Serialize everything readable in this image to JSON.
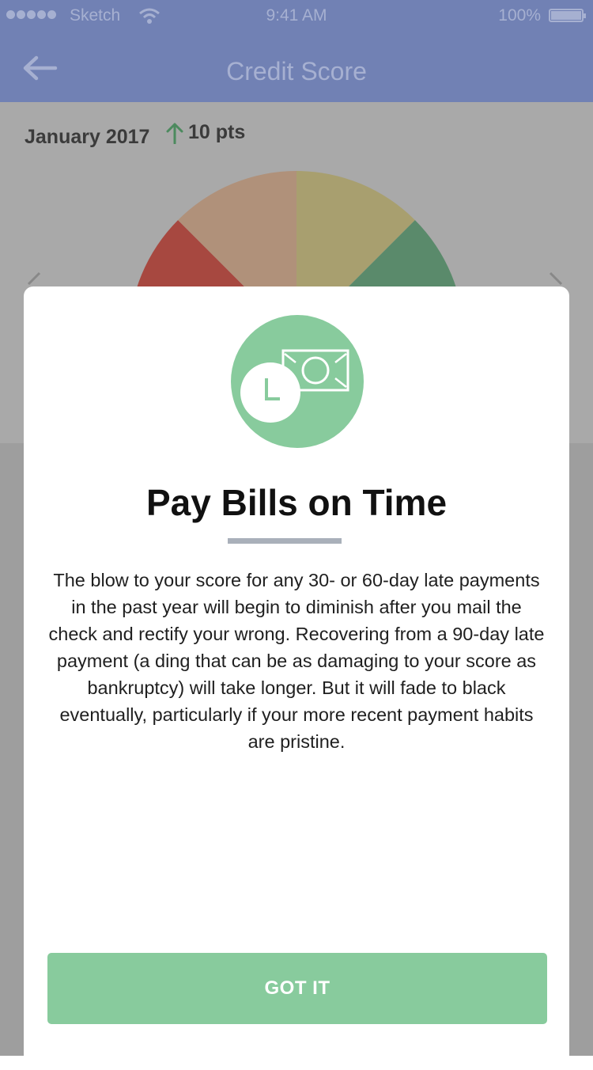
{
  "status_bar": {
    "carrier": "Sketch",
    "time": "9:41 AM",
    "battery": "100%"
  },
  "nav": {
    "title": "Credit Score",
    "back_icon": "arrow-left-icon"
  },
  "summary": {
    "month": "January 2017",
    "change": "10 pts",
    "change_icon": "arrow-up-icon"
  },
  "gauge": {
    "segments": [
      "#a74840",
      "#b0917a",
      "#a89f6f",
      "#5a8a6b"
    ]
  },
  "modal": {
    "icon": "clock-money-icon",
    "title": "Pay Bills on Time",
    "body": "The blow to your score for any 30- or 60-day late payments in the past year will begin to diminish after you mail the check and rectify your wrong. Recovering from a 90-day late payment (a ding that can be as damaging to your score as bankruptcy) will take longer. But it will fade to black eventually, particularly if your more recent payment habits are pristine.",
    "button_label": "GOT IT"
  },
  "colors": {
    "nav": "#7181b4",
    "accent": "#88cb9d",
    "overlay": "#a9a9a9"
  }
}
